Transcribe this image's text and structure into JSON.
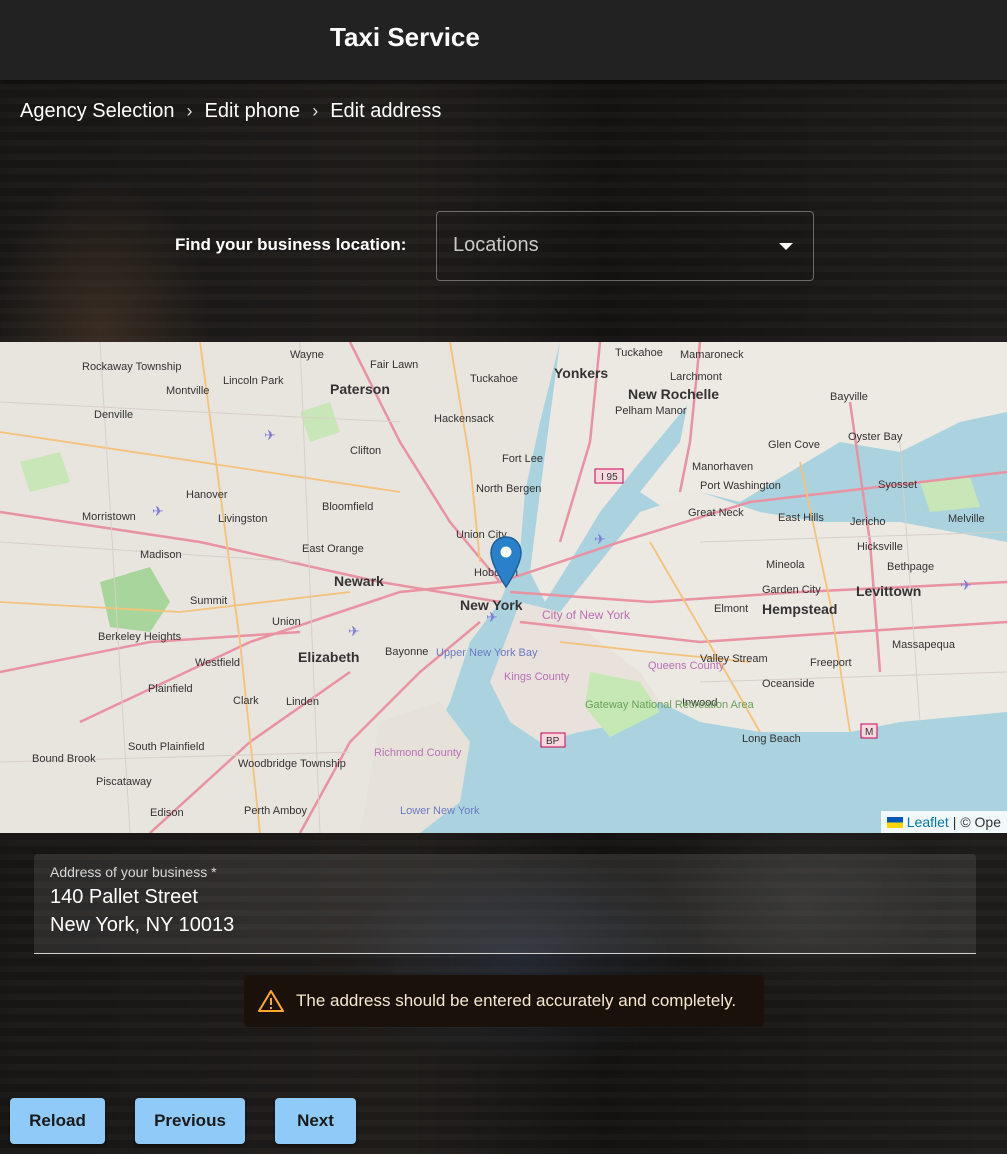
{
  "app": {
    "title": "Taxi Service"
  },
  "breadcrumb": {
    "items": [
      "Agency Selection",
      "Edit phone",
      "Edit address"
    ],
    "separator": "›"
  },
  "finder": {
    "label": "Find your business location:",
    "placeholder": "Locations"
  },
  "map": {
    "labels": {
      "new_york": "New York",
      "newark": "Newark",
      "paterson": "Paterson",
      "yonkers": "Yonkers",
      "new_rochelle": "New Rochelle",
      "elizabeth": "Elizabeth",
      "hempstead": "Hempstead",
      "levittown": "Levittown",
      "long_beach": "Long Beach",
      "hoboken": "Hoboken",
      "bayonne": "Bayonne",
      "morristown": "Morristown",
      "livingston": "Livingston",
      "union": "Union",
      "summit": "Summit",
      "edison": "Edison",
      "perth_amboy": "Perth Amboy",
      "plainfield": "Plainfield",
      "westfield": "Westfield",
      "clark": "Clark",
      "linden": "Linden",
      "madison": "Madison",
      "montville": "Montville",
      "wayne": "Wayne",
      "fair_lawn": "Fair Lawn",
      "hackensack": "Hackensack",
      "clifton": "Clifton",
      "fort_lee": "Fort Lee",
      "north_bergen": "North Bergen",
      "union_city": "Union City",
      "east_orange": "East Orange",
      "bloomfield": "Bloomfield",
      "mineola": "Mineola",
      "garden_city": "Garden City",
      "freeport": "Freeport",
      "oceanside": "Oceanside",
      "inwood": "Inwood",
      "great_neck": "Great Neck",
      "port_washington": "Port Washington",
      "glen_cove": "Glen Cove",
      "oyster_bay": "Oyster Bay",
      "bayville": "Bayville",
      "syosset": "Syosset",
      "hicksville": "Hicksville",
      "jericho": "Jericho",
      "east_hills": "East Hills",
      "melville": "Melville",
      "bethpage": "Bethpage",
      "massapequa": "Massapequa",
      "valley_stream": "Valley Stream",
      "elmont": "Elmont",
      "city_of_new_york": "City of New York",
      "kings_county": "Kings County",
      "queens_county": "Queens County",
      "richmond_county": "Richmond County",
      "gateway": "Gateway National Recreation Area",
      "upper_bay": "Upper New York Bay",
      "lower_bay": "Lower New York",
      "south_plainfield": "South Plainfield",
      "woodbridge": "Woodbridge Township",
      "piscataway": "Piscataway",
      "bound_brook": "Bound Brook",
      "berkeley_heights": "Berkeley Heights",
      "hanover": "Hanover",
      "denville": "Denville",
      "rockaway": "Rockaway Township",
      "lincoln_park": "Lincoln Park",
      "mamaroneck": "Mamaroneck",
      "larchmont": "Larchmont",
      "tuckahoe": "Tuckahoe",
      "pelham_manor": "Pelham Manor",
      "manorhaven": "Manorhaven",
      "i95": "I 95",
      "bp": "BP",
      "m": "M"
    },
    "attribution": {
      "leaflet": "Leaflet",
      "rest": "| © Ope"
    }
  },
  "address": {
    "label": "Address of your business *",
    "line1": "140 Pallet Street",
    "line2": "New York, NY 10013"
  },
  "alert": {
    "message": "The address should be entered accurately and completely."
  },
  "buttons": {
    "reload": "Reload",
    "previous": "Previous",
    "next": "Next"
  }
}
